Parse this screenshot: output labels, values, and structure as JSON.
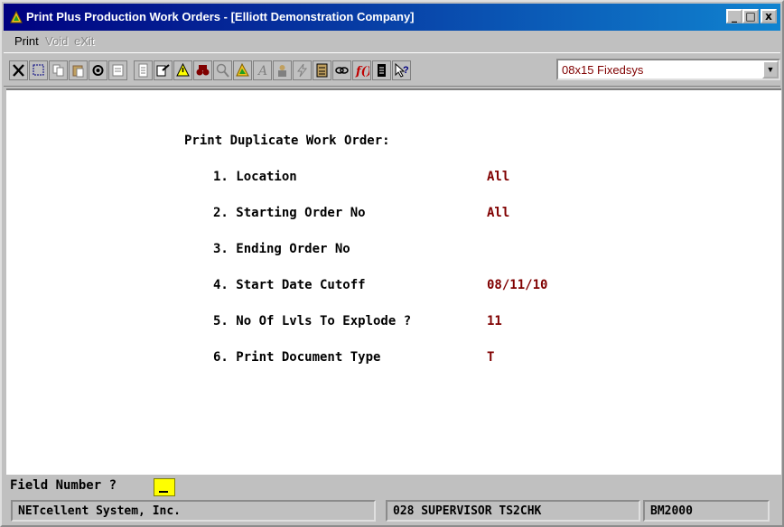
{
  "window": {
    "title": "Print Plus Production Work Orders - [Elliott Demonstration Company]",
    "controls": [
      "_",
      "□",
      "x"
    ]
  },
  "menu": {
    "items": [
      {
        "label": "Print",
        "enabled": true
      },
      {
        "label": "Void",
        "enabled": false
      },
      {
        "label": "eXit",
        "enabled": false
      }
    ]
  },
  "toolbar": {
    "icons": [
      "close-x-icon",
      "select-icon",
      "copy-icon",
      "paste-icon",
      "settings-icon",
      "properties-icon",
      "notes-icon",
      "export-icon",
      "alert-icon",
      "binoculars-icon",
      "zoom-icon",
      "elliott-icon",
      "font-a-icon",
      "person-icon",
      "lightning-icon",
      "calculator-icon",
      "link-icon",
      "function-icon",
      "notepad-icon",
      "help-cursor-icon"
    ],
    "font_select": "08x15 Fixedsys"
  },
  "form": {
    "heading": "Print Duplicate Work Order:",
    "fields": [
      {
        "label": "1. Location",
        "value": "All"
      },
      {
        "label": "2. Starting Order No",
        "value": "All"
      },
      {
        "label": "3. Ending Order No",
        "value": ""
      },
      {
        "label": "4. Start Date Cutoff",
        "value": "08/11/10"
      },
      {
        "label": "5. No Of Lvls To Explode ?",
        "value": "11"
      },
      {
        "label": "6. Print Document Type",
        "value": "T"
      }
    ]
  },
  "prompt": {
    "label": "Field Number ?"
  },
  "status": {
    "company": "NETcellent System, Inc.",
    "session": "028 SUPERVISOR TS2CHK",
    "module": "BM2000"
  },
  "colors": {
    "title_start": "#000080",
    "title_end": "#1084d0",
    "value": "#800000",
    "cursor": "#ffff00"
  }
}
